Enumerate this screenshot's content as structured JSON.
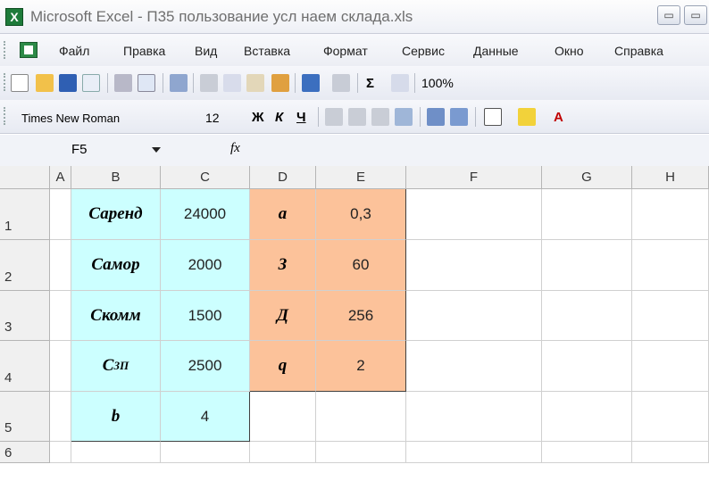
{
  "window": {
    "title": "Microsoft Excel - П35 пользование усл наем склада.xls",
    "min_btn": "▭",
    "restore_btn": "▭"
  },
  "menu": [
    "Файл",
    "Правка",
    "Вид",
    "Вставка",
    "Формат",
    "Сервис",
    "Данные",
    "Окно",
    "Справка"
  ],
  "toolbar": {
    "sigma": "Σ",
    "zoom": "100%"
  },
  "format_toolbar": {
    "font": "Times New Roman",
    "size": "12",
    "bold": "Ж",
    "italic": "К",
    "underline": "Ч",
    "font_color_letter": "A"
  },
  "formula_bar": {
    "cell_ref": "F5",
    "fx": "fx"
  },
  "columns": [
    "A",
    "B",
    "C",
    "D",
    "E",
    "F",
    "G",
    "H"
  ],
  "rows": [
    "1",
    "2",
    "3",
    "4",
    "5",
    "6"
  ],
  "cells": {
    "B1": "Саренд",
    "C1": "24000",
    "D1": "a",
    "E1": "0,3",
    "B2": "Самор",
    "C2": "2000",
    "D2": "З",
    "E2": "60",
    "B3": "Скомм",
    "C3": "1500",
    "D3": "Д",
    "E3": "256",
    "B4_main": "С",
    "B4_sub": "ЗП",
    "C4": "2500",
    "D4": "q",
    "E4": "2",
    "B5": "b",
    "C5": "4"
  },
  "colors": {
    "cyan_fill": "#ccffff",
    "orange_fill": "#fcc29a",
    "excel_green": "#1e7b3a"
  }
}
